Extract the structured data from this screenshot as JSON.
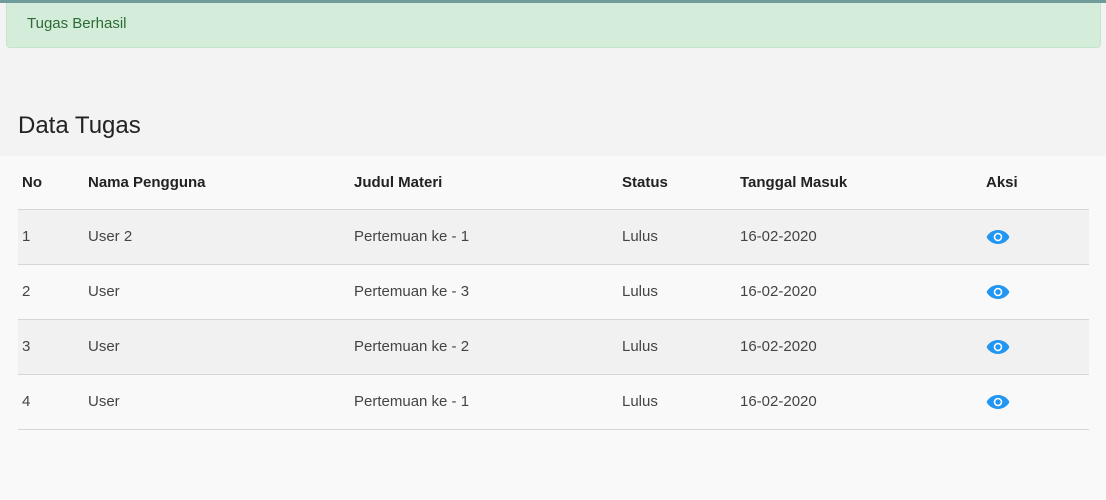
{
  "alert": {
    "message": "Tugas Berhasil"
  },
  "page": {
    "title": "Data Tugas"
  },
  "table": {
    "headers": [
      "No",
      "Nama Pengguna",
      "Judul Materi",
      "Status",
      "Tanggal Masuk",
      "Aksi"
    ],
    "rows": [
      {
        "no": "1",
        "nama": "User 2",
        "judul": "Pertemuan ke - 1",
        "status": "Lulus",
        "tanggal": "16-02-2020",
        "aksi_icon": "eye-icon"
      },
      {
        "no": "2",
        "nama": "User",
        "judul": "Pertemuan ke - 3",
        "status": "Lulus",
        "tanggal": "16-02-2020",
        "aksi_icon": "eye-icon"
      },
      {
        "no": "3",
        "nama": "User",
        "judul": "Pertemuan ke - 2",
        "status": "Lulus",
        "tanggal": "16-02-2020",
        "aksi_icon": "eye-icon"
      },
      {
        "no": "4",
        "nama": "User",
        "judul": "Pertemuan ke - 1",
        "status": "Lulus",
        "tanggal": "16-02-2020",
        "aksi_icon": "eye-icon"
      }
    ]
  },
  "colors": {
    "accent": "#2196f3",
    "alert_bg": "#d4edda",
    "alert_text": "#2e6b35"
  }
}
